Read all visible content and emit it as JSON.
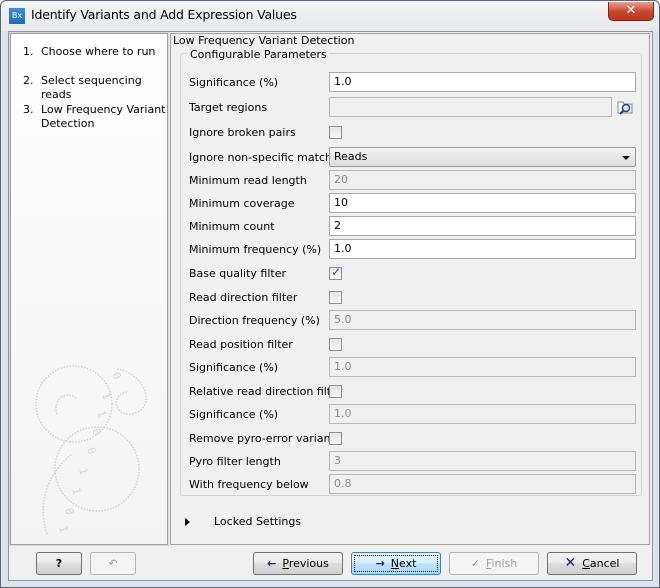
{
  "window": {
    "title": "Identify Variants and Add Expression Values",
    "app_icon_text": "Bx",
    "close_label": "✕"
  },
  "steps": [
    {
      "num": "1.",
      "label": "Choose where to run"
    },
    {
      "num": "2.",
      "label": "Select sequencing reads"
    },
    {
      "num": "3.",
      "label": "Low Frequency Variant Detection"
    }
  ],
  "main": {
    "title": "Low Frequency Variant Detection",
    "group_title": "Configurable Parameters",
    "params": {
      "significance": {
        "label": "Significance (%)",
        "value": "1.0"
      },
      "target_regions": {
        "label": "Target regions",
        "value": ""
      },
      "ignore_broken_pairs": {
        "label": "Ignore broken pairs",
        "checked": false
      },
      "ignore_nonspecific": {
        "label": "Ignore non-specific matches",
        "value": "Reads"
      },
      "min_read_length": {
        "label": "Minimum read length",
        "value": "20"
      },
      "min_coverage": {
        "label": "Minimum coverage",
        "value": "10"
      },
      "min_count": {
        "label": "Minimum count",
        "value": "2"
      },
      "min_frequency": {
        "label": "Minimum frequency (%)",
        "value": "1.0"
      },
      "base_quality_filter": {
        "label": "Base quality filter",
        "checked": true
      },
      "read_direction_filter": {
        "label": "Read direction filter",
        "checked": false
      },
      "direction_frequency": {
        "label": "Direction frequency (%)",
        "value": "5.0"
      },
      "read_position_filter": {
        "label": "Read position filter",
        "checked": false
      },
      "read_position_significance": {
        "label": "Significance (%)",
        "value": "1.0"
      },
      "relative_read_direction_filter": {
        "label": "Relative read direction filter",
        "checked": false
      },
      "relative_significance": {
        "label": "Significance (%)",
        "value": "1.0"
      },
      "remove_pyro_error": {
        "label": "Remove pyro-error variants",
        "checked": false
      },
      "pyro_filter_length": {
        "label": "Pyro filter length",
        "value": "3"
      },
      "with_frequency_below": {
        "label": "With frequency below",
        "value": "0.8"
      }
    },
    "locked_settings_label": "Locked Settings"
  },
  "buttons": {
    "help": "?",
    "reset": "↶",
    "previous_mnemonic": "P",
    "previous_rest": "revious",
    "next_mnemonic": "N",
    "next_rest": "ext",
    "finish_mnemonic": "F",
    "finish_rest": "inish",
    "cancel_mnemonic": "C",
    "cancel_rest": "ancel"
  }
}
